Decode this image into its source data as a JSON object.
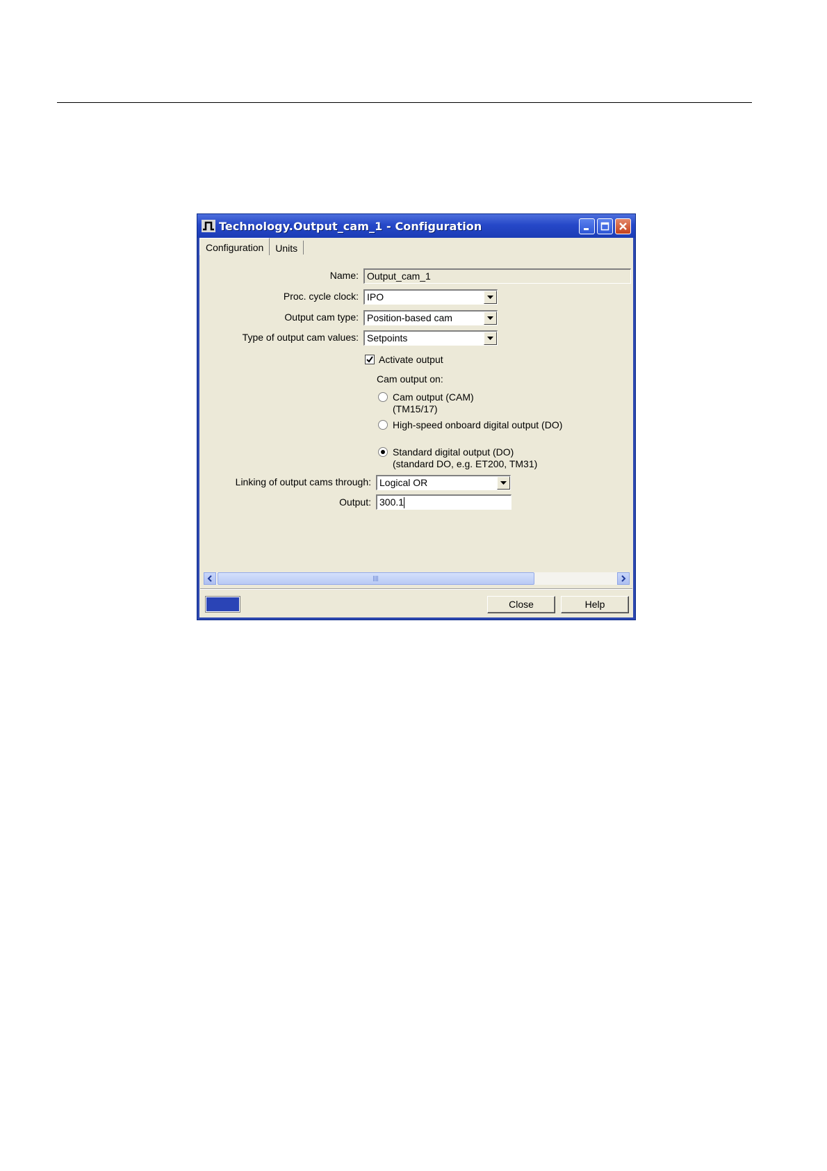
{
  "window": {
    "title": "Technology.Output_cam_1  - Configuration",
    "tabs": [
      {
        "label": "Configuration"
      },
      {
        "label": "Units"
      }
    ]
  },
  "form": {
    "name_label": "Name:",
    "name_value": "Output_cam_1",
    "proc_cycle_clock_label": "Proc. cycle clock:",
    "proc_cycle_clock_value": "IPO",
    "output_cam_type_label": "Output cam type:",
    "output_cam_type_value": "Position-based cam",
    "type_of_values_label": "Type of output cam values:",
    "type_of_values_value": "Setpoints",
    "activate_output_label": "Activate output",
    "activate_output_checked": true,
    "cam_output_on_label": "Cam output on:",
    "radio_options": [
      {
        "line1": "Cam output (CAM)",
        "line2": "(TM15/17)",
        "selected": false
      },
      {
        "line1": "High-speed onboard digital output (DO)",
        "line2": "",
        "selected": false
      },
      {
        "line1": "Standard digital output (DO)",
        "line2": "(standard DO, e.g. ET200, TM31)",
        "selected": true
      }
    ],
    "linking_label": "Linking of output cams through:",
    "linking_value": "Logical OR",
    "output_label": "Output:",
    "output_value": "300.1"
  },
  "buttons": {
    "close_label": "Close",
    "help_label": "Help"
  },
  "colors": {
    "titlebar": "#2648c8",
    "dialog_bg": "#ece9d8",
    "status_swatch": "#2a44b6"
  }
}
